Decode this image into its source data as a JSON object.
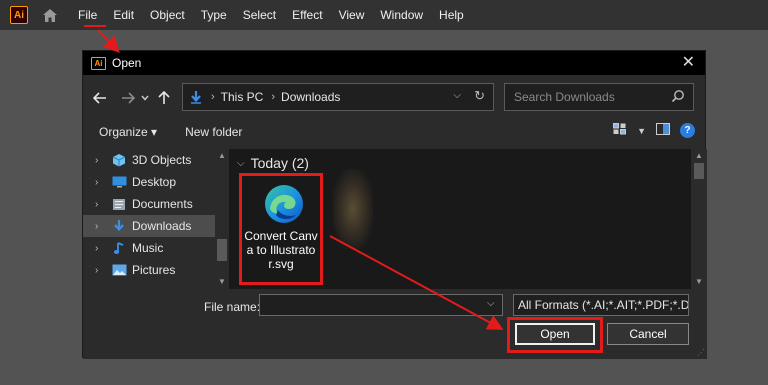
{
  "app": {
    "logo_text": "Ai",
    "menu": [
      "File",
      "Edit",
      "Object",
      "Type",
      "Select",
      "Effect",
      "View",
      "Window",
      "Help"
    ]
  },
  "dialog": {
    "title": "Open",
    "logo_text": "Ai",
    "close_label": "✕",
    "breadcrumb": [
      "This PC",
      "Downloads"
    ],
    "search_placeholder": "Search Downloads",
    "toolbar": {
      "organize": "Organize ▾",
      "new_folder": "New folder",
      "help": "?"
    },
    "nav_items": [
      {
        "label": "3D Objects",
        "icon": "cube-icon"
      },
      {
        "label": "Desktop",
        "icon": "desktop-icon"
      },
      {
        "label": "Documents",
        "icon": "documents-icon"
      },
      {
        "label": "Downloads",
        "icon": "download-arrow-icon",
        "selected": true
      },
      {
        "label": "Music",
        "icon": "music-note-icon"
      },
      {
        "label": "Pictures",
        "icon": "pictures-icon"
      }
    ],
    "group": {
      "label": "Today (2)"
    },
    "file": {
      "name": "Convert Canva to Illustrator.svg",
      "icon": "edge-icon"
    },
    "file_name_label": "File name:",
    "file_name_value": "",
    "format": "All Formats (*.AI;*.AIT;*.PDF;*.D",
    "open_button": "Open",
    "cancel_button": "Cancel"
  },
  "colors": {
    "annotation_red": "#e31b1b",
    "ai_orange": "#ff9a00",
    "accent_blue": "#2a7de1"
  }
}
